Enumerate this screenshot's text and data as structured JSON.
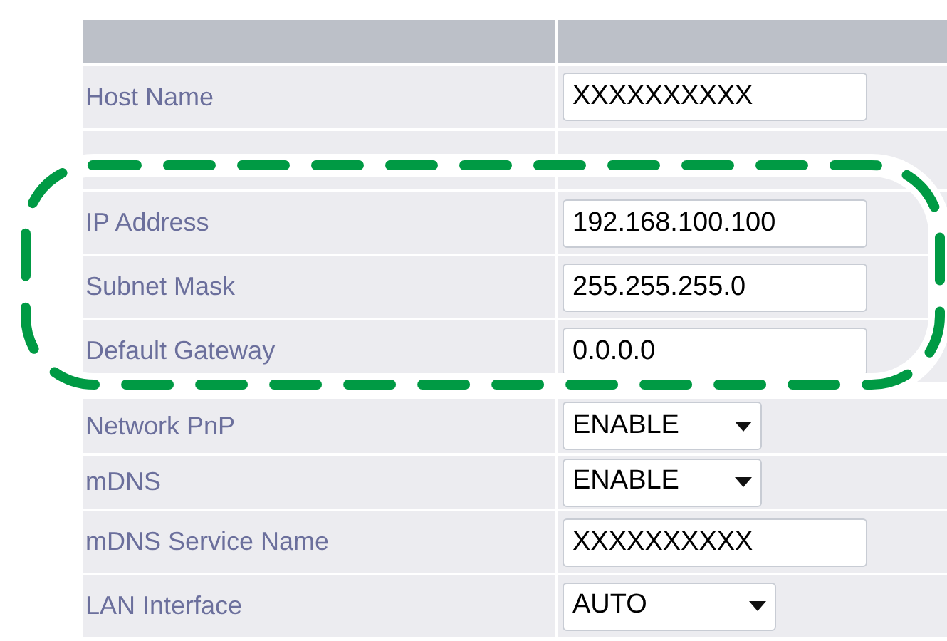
{
  "rows": [
    {
      "label": "Host Name",
      "kind": "text",
      "value": "XXXXXXXXXX"
    },
    {
      "label": "IP Address",
      "kind": "text",
      "value": "192.168.100.100"
    },
    {
      "label": "Subnet Mask",
      "kind": "text",
      "value": "255.255.255.0"
    },
    {
      "label": "Default Gateway",
      "kind": "text",
      "value": "0.0.0.0"
    },
    {
      "label": "Network PnP",
      "kind": "select",
      "value": "ENABLE"
    },
    {
      "label": "mDNS",
      "kind": "select",
      "value": "ENABLE"
    },
    {
      "label": "mDNS Service Name",
      "kind": "text",
      "value": "XXXXXXXXXX"
    },
    {
      "label": "LAN Interface",
      "kind": "select",
      "value": "AUTO"
    }
  ]
}
